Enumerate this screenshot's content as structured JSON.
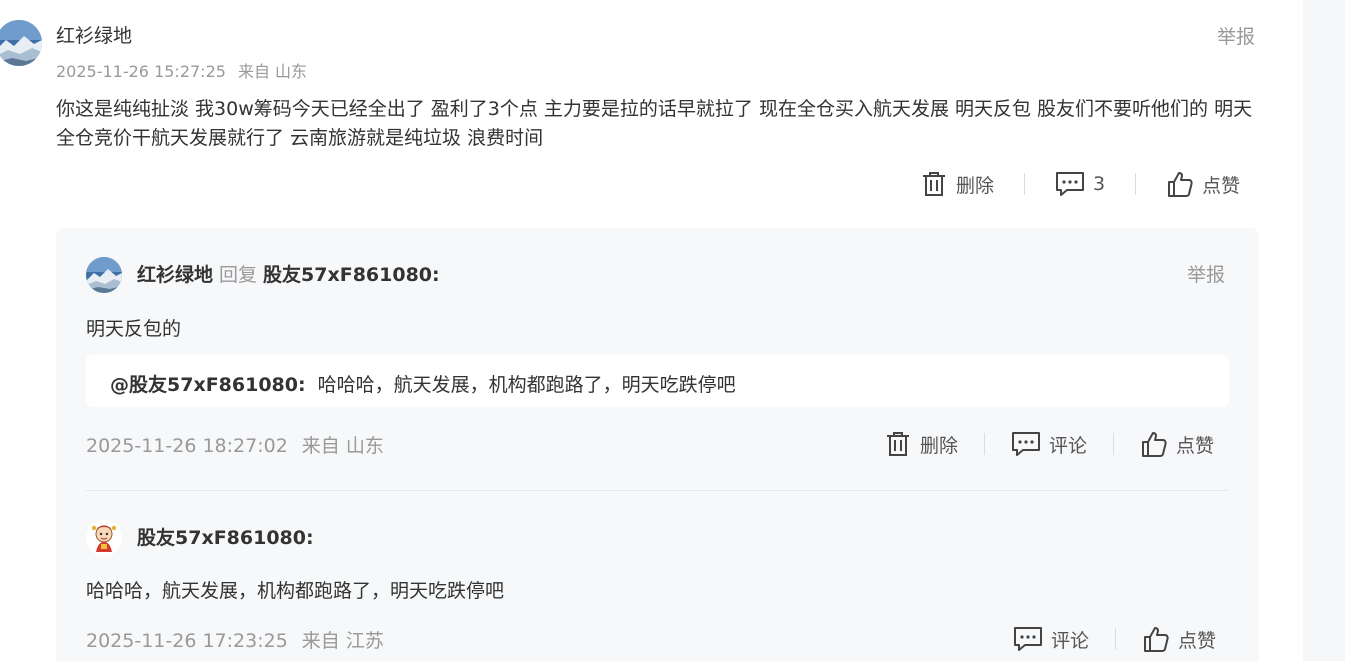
{
  "main_comment": {
    "author": "红衫绿地",
    "timestamp": "2025-11-26 15:27:25",
    "location": "来自 山东",
    "report_label": "举报",
    "body": "你这是纯纯扯淡 我30w筹码今天已经全出了 盈利了3个点 主力要是拉的话早就拉了 现在全仓买入航天发展 明天反包 股友们不要听他们的 明天全仓竞价干航天发展就行了 云南旅游就是纯垃圾 浪费时间",
    "actions": {
      "delete_label": "删除",
      "comment_count": "3",
      "like_label": "点赞"
    }
  },
  "replies": [
    {
      "author": "红衫绿地",
      "reply_verb": "回复",
      "reply_to": "股友57xF861080:",
      "report_label": "举报",
      "body": "明天反包的",
      "quote": {
        "mention": "@股友57xF861080:",
        "text": "哈哈哈，航天发展，机构都跑路了，明天吃跌停吧"
      },
      "timestamp": "2025-11-26 18:27:02",
      "location": "来自 山东",
      "actions": {
        "delete_label": "删除",
        "comment_label": "评论",
        "like_label": "点赞"
      }
    },
    {
      "author": "股友57xF861080:",
      "body": "哈哈哈，航天发展，机构都跑路了，明天吃跌停吧",
      "timestamp": "2025-11-26 17:23:25",
      "location": "来自 江苏",
      "actions": {
        "comment_label": "评论",
        "like_label": "点赞"
      }
    }
  ],
  "icons": {
    "delete": "trash-icon",
    "comment": "comment-bubble-icon",
    "like": "thumbs-up-icon",
    "avatar_main": "mountain-landscape-avatar",
    "avatar_user2": "cartoon-figure-avatar"
  },
  "colors": {
    "text_primary": "#333333",
    "text_secondary": "#999999",
    "panel_bg": "#f7f8fa",
    "quote_bg": "#ffffff"
  }
}
